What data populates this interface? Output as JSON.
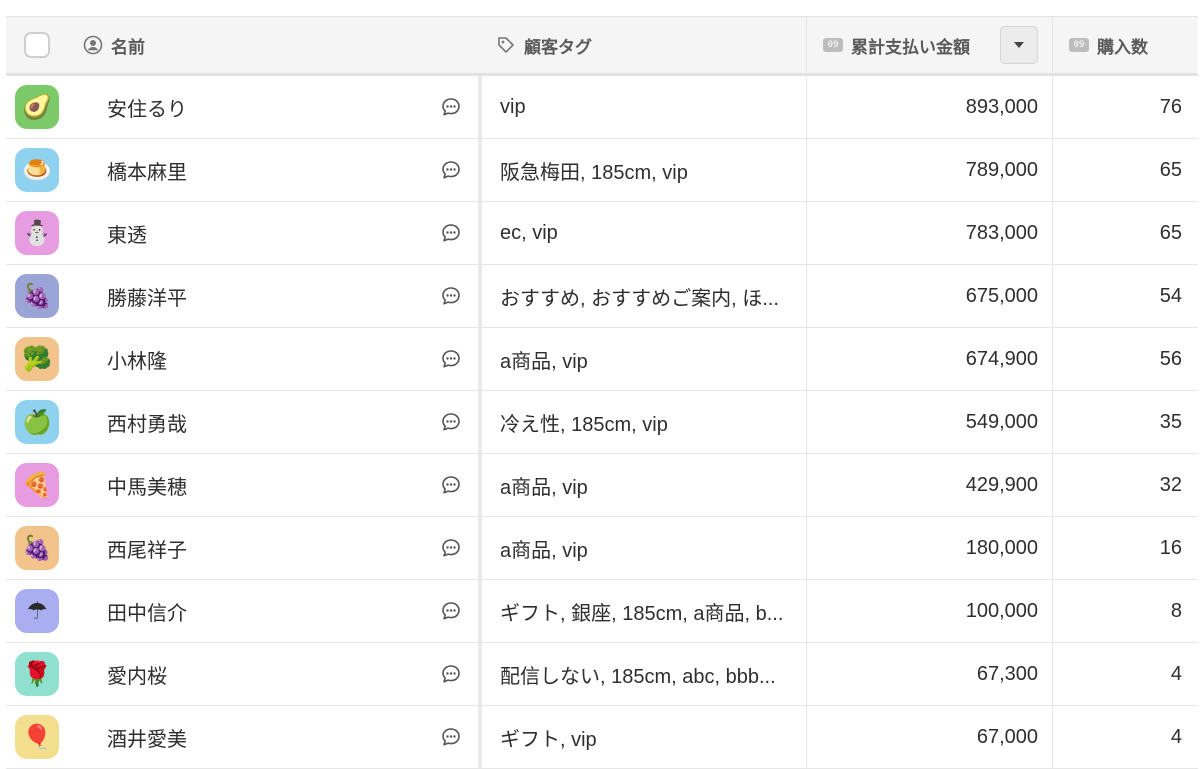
{
  "header": {
    "name_label": "名前",
    "tags_label": "顧客タグ",
    "amount_label": "累計支払い金額",
    "count_label": "購入数",
    "number_icon_text": "09",
    "icons": {
      "name": "person-circle-icon",
      "tags": "tag-icon",
      "amount": "number-field-icon",
      "count": "number-field-icon",
      "sort": "chevron-down-icon"
    }
  },
  "rows": [
    {
      "avatar": "🥑",
      "avatar_color": "#7cc96a",
      "name": "安住るり",
      "tags": "vip",
      "amount": "893,000",
      "count": "76"
    },
    {
      "avatar": "🍮",
      "avatar_color": "#8fd2f0",
      "name": "橋本麻里",
      "tags": "阪急梅田, 185cm, vip",
      "amount": "789,000",
      "count": "65"
    },
    {
      "avatar": "⛄",
      "avatar_color": "#e79be0",
      "name": "東透",
      "tags": "ec, vip",
      "amount": "783,000",
      "count": "65"
    },
    {
      "avatar": "🍇",
      "avatar_color": "#9aa4d6",
      "name": "勝藤洋平",
      "tags": "おすすめ, おすすめご案内, ほ...",
      "amount": "675,000",
      "count": "54"
    },
    {
      "avatar": "🥦",
      "avatar_color": "#f2c48b",
      "name": "小林隆",
      "tags": "a商品, vip",
      "amount": "674,900",
      "count": "56"
    },
    {
      "avatar": "🍏",
      "avatar_color": "#8fd2f0",
      "name": "西村勇哉",
      "tags": "冷え性, 185cm, vip",
      "amount": "549,000",
      "count": "35"
    },
    {
      "avatar": "🍕",
      "avatar_color": "#e79be0",
      "name": "中馬美穂",
      "tags": "a商品, vip",
      "amount": "429,900",
      "count": "32"
    },
    {
      "avatar": "🍇",
      "avatar_color": "#f2c48b",
      "name": "西尾祥子",
      "tags": "a商品, vip",
      "amount": "180,000",
      "count": "16"
    },
    {
      "avatar": "☂",
      "avatar_color": "#a9aef0",
      "name": "田中信介",
      "tags": "ギフト, 銀座, 185cm, a商品, b...",
      "amount": "100,000",
      "count": "8"
    },
    {
      "avatar": "🌹",
      "avatar_color": "#8fe0cf",
      "name": "愛内桜",
      "tags": "配信しない, 185cm, abc, bbb...",
      "amount": "67,300",
      "count": "4"
    },
    {
      "avatar": "🎈",
      "avatar_color": "#f3de8e",
      "name": "酒井愛美",
      "tags": "ギフト, vip",
      "amount": "67,000",
      "count": "4"
    }
  ],
  "row_icons": {
    "avatar": "emoji-avatar",
    "comment": "comment-bubble-icon"
  }
}
